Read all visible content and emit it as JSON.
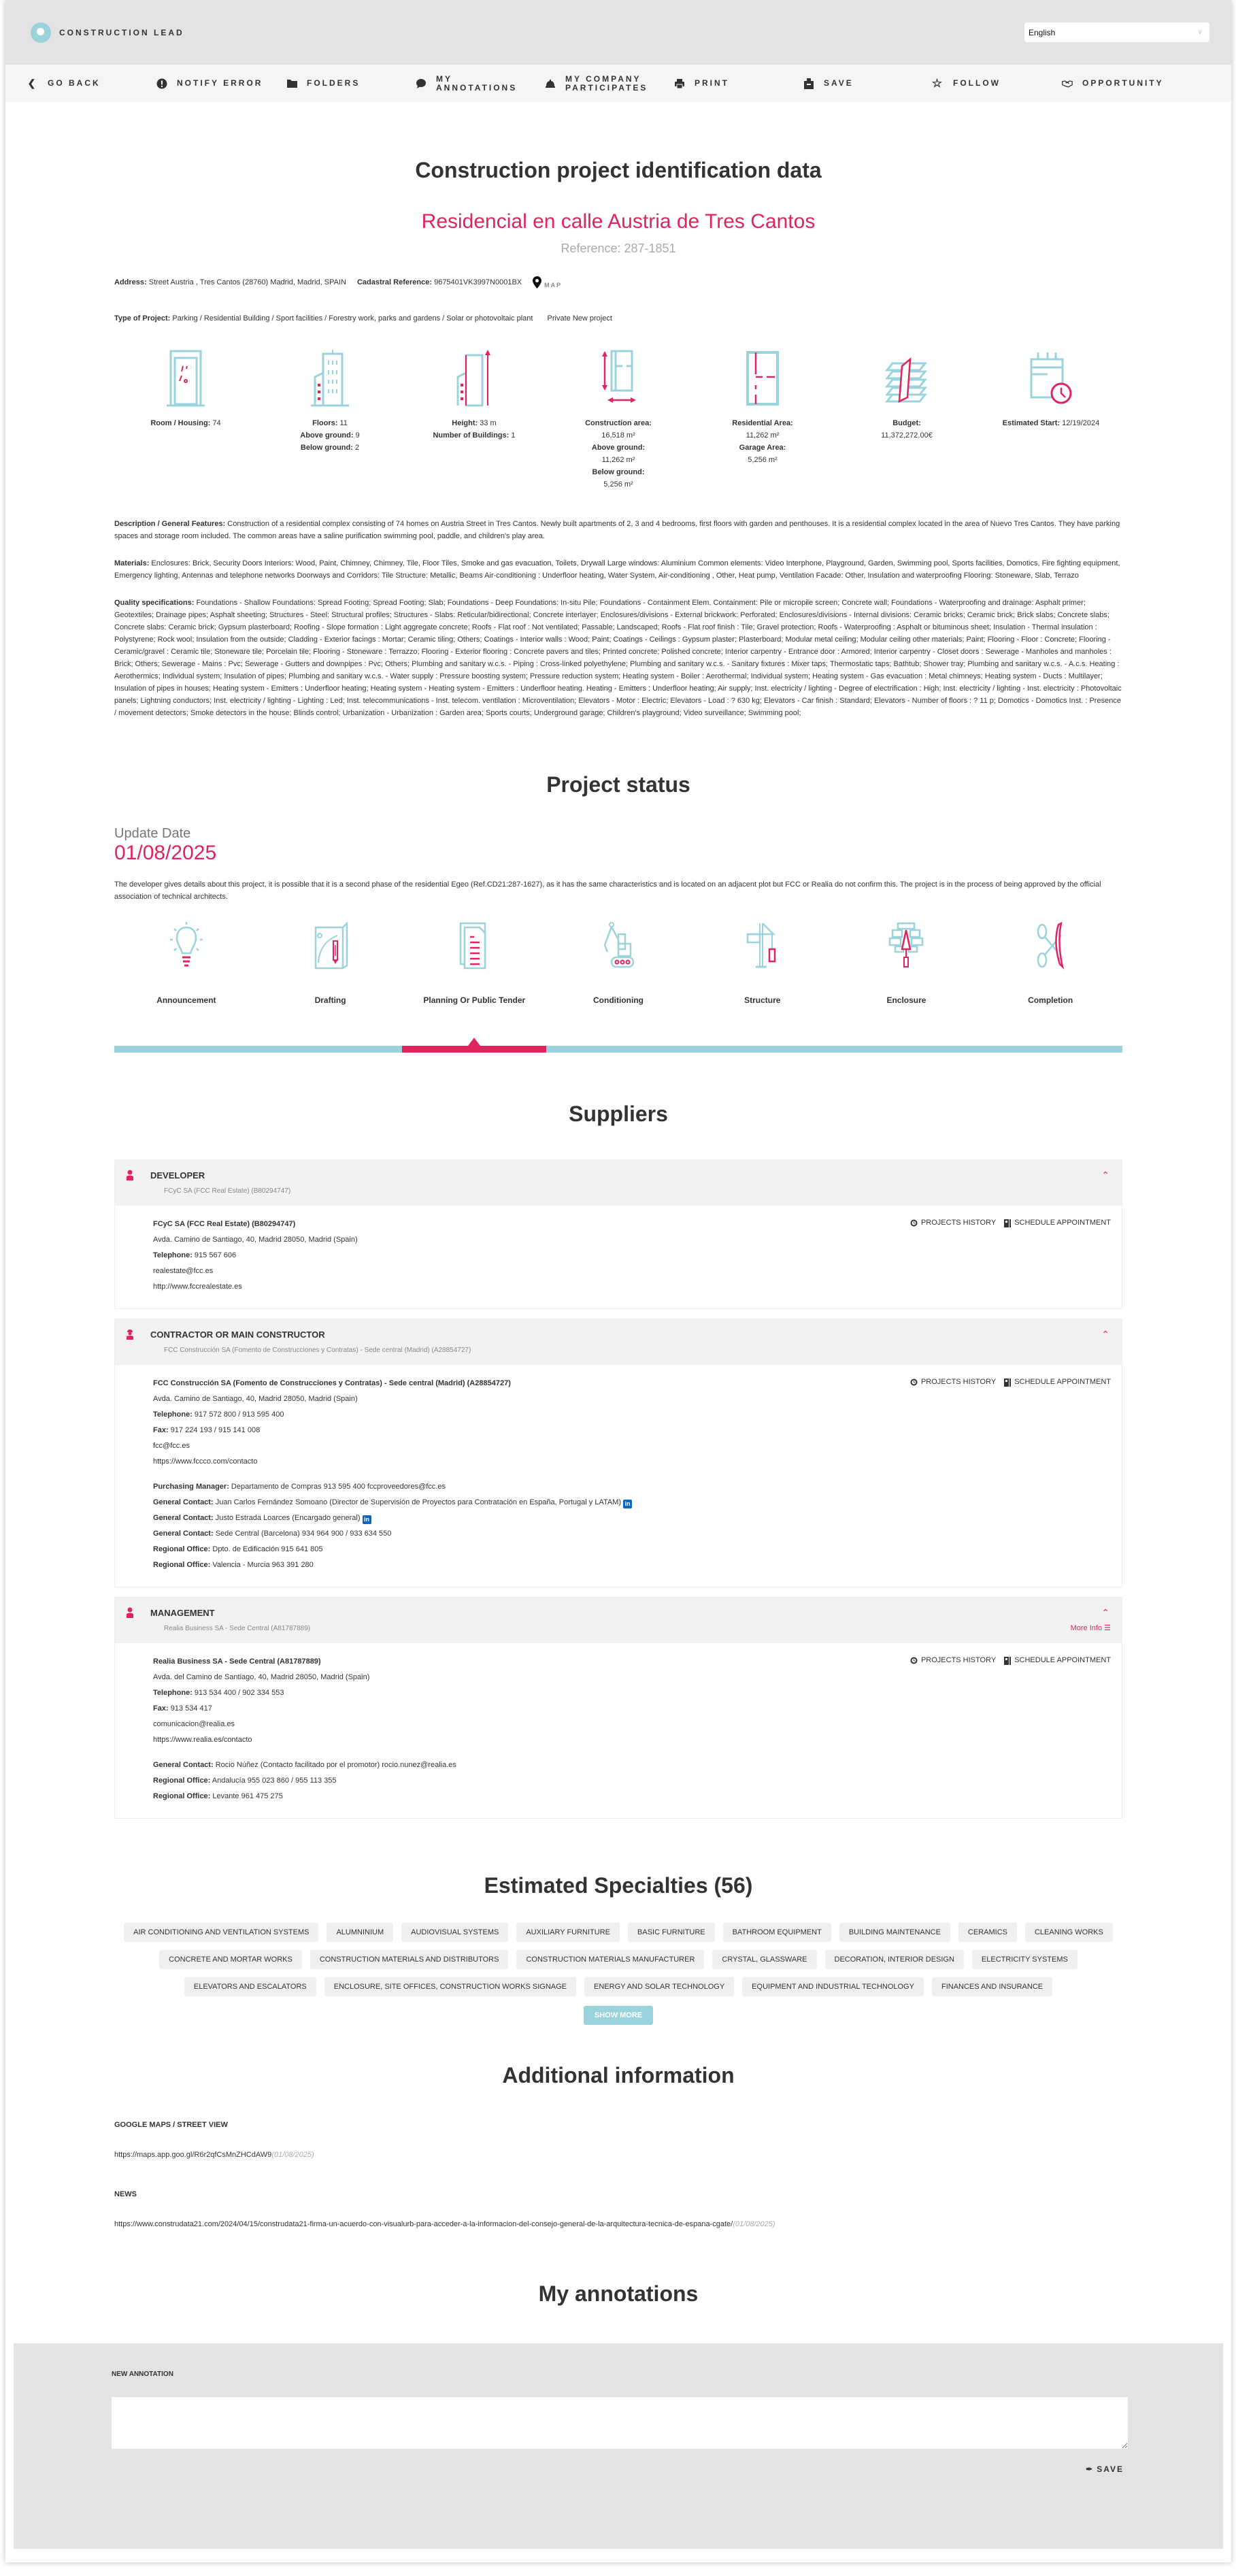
{
  "header": {
    "brand": "CONSTRUCTION LEAD",
    "language": "English"
  },
  "toolbar": {
    "items": [
      {
        "label": "GO BACK",
        "icon": "chevron-left-icon"
      },
      {
        "label": "NOTIFY ERROR",
        "icon": "exclamation-icon"
      },
      {
        "label": "FOLDERS",
        "icon": "folder-icon"
      },
      {
        "label": "MY ANNOTATIONS",
        "icon": "comment-icon"
      },
      {
        "label": "MY COMPANY PARTICIPATES",
        "icon": "hardhat-icon"
      },
      {
        "label": "PRINT",
        "icon": "print-icon"
      },
      {
        "label": "SAVE",
        "icon": "save-icon"
      },
      {
        "label": "FOLLOW",
        "icon": "star-icon"
      },
      {
        "label": "OPPORTUNITY",
        "icon": "handshake-icon"
      }
    ]
  },
  "identification": {
    "section_title": "Construction project identification data",
    "project_name": "Residencial en calle Austria de Tres Cantos",
    "reference": "Reference: 287-1851",
    "address_label": "Address:",
    "address": "Street Austria , Tres Cantos (28760) Madrid, Madrid, SPAIN",
    "cadastral_label": "Cadastral Reference:",
    "cadastral": "9675401VK3997N0001BX",
    "map_label": "MAP",
    "type_label": "Type of Project:",
    "type": "Parking / Residential Building / Sport facilities / Forestry work, parks and gardens / Solar or photovoltaic plant",
    "ownership": "Private New project"
  },
  "stats": [
    {
      "icon": "door-icon",
      "lines": [
        {
          "label": "Room / Housing:",
          "value": "74"
        }
      ]
    },
    {
      "icon": "building-floors-icon",
      "lines": [
        {
          "label": "Floors:",
          "value": "11"
        },
        {
          "label": "Above ground:",
          "value": "9"
        },
        {
          "label": "Below ground:",
          "value": "2"
        }
      ]
    },
    {
      "icon": "building-height-icon",
      "lines": [
        {
          "label": "Height:",
          "value": "33 m"
        },
        {
          "label": "Number of Buildings:",
          "value": "1"
        }
      ]
    },
    {
      "icon": "construction-area-icon",
      "lines": [
        {
          "label": "Construction area:",
          "value": ""
        },
        {
          "label": "",
          "value": "16,518 m²"
        },
        {
          "label": "Above ground:",
          "value": ""
        },
        {
          "label": "",
          "value": "11,262 m²"
        },
        {
          "label": "Below ground:",
          "value": ""
        },
        {
          "label": "",
          "value": "5,256 m²"
        }
      ]
    },
    {
      "icon": "floor-plan-icon",
      "lines": [
        {
          "label": "Residential Area:",
          "value": ""
        },
        {
          "label": "",
          "value": "11,262 m²"
        },
        {
          "label": "Garage Area:",
          "value": ""
        },
        {
          "label": "",
          "value": "5,256 m²"
        }
      ]
    },
    {
      "icon": "budget-icon",
      "lines": [
        {
          "label": "Budget:",
          "value": ""
        },
        {
          "label": "",
          "value": "11,372,272.00€"
        }
      ]
    },
    {
      "icon": "calendar-clock-icon",
      "lines": [
        {
          "label": "Estimated Start:",
          "value": "12/19/2024"
        }
      ]
    }
  ],
  "description": {
    "label": "Description / General Features:",
    "text": "Construction of a residential complex consisting of 74 homes on Austria Street in Tres Cantos. Newly built apartments of 2, 3 and 4 bedrooms, first floors with garden and penthouses. It is a residential complex located in the area of Nuevo Tres Cantos. They have parking spaces and storage room included. The common areas have a saline purification swimming pool, paddle, and children's play area."
  },
  "materials": {
    "label": "Materials:",
    "text": "Enclosures: Brick, Security Doors Interiors: Wood, Paint, Chimney, Chimney, Tile, Floor Tiles, Smoke and gas evacuation, Toilets, Drywall Large windows: Aluminium Common elements: Video Interphone, Playground, Garden, Swimming pool, Sports facilities, Domotics, Fire fighting equipment, Emergency lighting, Antennas and telephone networks Doorways and Corridors: Tile Structure: Metallic, Beams Air-conditioning : Underfloor heating, Water System, Air-conditioning , Other, Heat pump, Ventilation Facade: Other, Insulation and waterproofing Flooring: Stoneware, Slab, Terrazo"
  },
  "quality": {
    "label": "Quality specifications:",
    "text": "Foundations - Shallow Foundations: Spread Footing; Spread Footing; Slab; Foundations - Deep Foundations: In-situ Pile; Foundations - Containment Elem. Containment: Pile or micropile screen; Concrete wall; Foundations - Waterproofing and drainage: Asphalt primer; Geotextiles; Drainage pipes; Asphalt sheeting; Structures - Steel: Structural profiles; Structures - Slabs: Reticular/bidirectional; Concrete interlayer; Enclosures/divisions - External brickwork: Perforated; Enclosures/divisions - Internal divisions: Ceramic bricks; Ceramic brick; Brick slabs; Concrete slabs; Concrete slabs: Ceramic brick; Gypsum plasterboard; Roofing - Slope formation : Light aggregate concrete; Roofs - Flat roof : Not ventilated; Passable; Landscaped; Roofs - Flat roof finish : Tile; Gravel protection; Roofs - Waterproofing : Asphalt or bituminous sheet; Insulation - Thermal insulation : Polystyrene; Rock wool; Insulation from the outside; Cladding - Exterior facings : Mortar; Ceramic tiling; Others; Coatings - Interior walls : Wood; Paint; Coatings - Ceilings : Gypsum plaster; Plasterboard; Modular metal ceiling; Modular ceiling other materials; Paint; Flooring - Floor : Concrete; Flooring - Ceramic/gravel : Ceramic tile; Stoneware tile; Porcelain tile; Flooring - Stoneware : Terrazzo; Flooring - Exterior flooring : Concrete pavers and tiles; Printed concrete; Polished concrete; Interior carpentry - Entrance door : Armored; Interior carpentry - Closet doors : Sewerage - Manholes and manholes : Brick; Others; Sewerage - Mains : Pvc; Sewerage - Gutters and downpipes : Pvc; Others; Plumbing and sanitary w.c.s. - Piping : Cross-linked polyethylene; Plumbing and sanitary w.c.s. - Sanitary fixtures : Mixer taps; Thermostatic taps; Bathtub; Shower tray; Plumbing and sanitary w.c.s. - A.c.s. Heating : Aerothermics; Individual system; Insulation of pipes; Plumbing and sanitary w.c.s. - Water supply : Pressure boosting system; Pressure reduction system; Heating system - Boiler : Aerothermal; Individual system; Heating system - Gas evacuation : Metal chimneys; Heating system - Ducts : Multilayer; Insulation of pipes in houses; Heating system - Emitters : Underfloor heating; Heating system - Heating system - Emitters : Underfloor heating. Heating - Emitters : Underfloor heating; Air supply; Inst. electricity / lighting - Degree of electrification : High; Inst. electricity / lighting - Inst. electricity : Photovoltaic panels; Lightning conductors; Inst. electricity / lighting - Lighting : Led; Inst. telecommunications - Inst. telecom. ventilation : Microventilation; Elevators - Motor : Electric; Elevators - Load : ? 630 kg; Elevators - Car finish : Standard; Elevators - Number of floors : ? 11 p; Domotics - Domotics Inst. : Presence / movement detectors; Smoke detectors in the house; Blinds control; Urbanization - Urbanization : Garden area; Sports courts; Underground garage; Children's playground; Video surveillance; Swimming pool;"
  },
  "status": {
    "section_title": "Project status",
    "update_label": "Update Date",
    "update_date": "01/08/2025",
    "note": "The developer gives details about this project, it is possible that it is a second phase of the residential Egeo (Ref.CD21:287-1627), as it has the same characteristics and is located on an adjacent plot but FCC or Realia do not confirm this. The project is in the process of being approved by the official association of technical architects.",
    "phases": [
      {
        "label": "Announcement",
        "icon": "lightbulb-icon"
      },
      {
        "label": "Drafting",
        "icon": "blueprint-pencil-icon"
      },
      {
        "label": "Planning Or Public Tender",
        "icon": "document-list-icon"
      },
      {
        "label": "Conditioning",
        "icon": "excavator-icon"
      },
      {
        "label": "Structure",
        "icon": "crane-icon"
      },
      {
        "label": "Enclosure",
        "icon": "trowel-bricks-icon"
      },
      {
        "label": "Completion",
        "icon": "scissors-ribbon-icon"
      }
    ],
    "current_phase_index": 2,
    "total_phases": 7
  },
  "suppliers": {
    "section_title": "Suppliers",
    "projects_history_label": "PROJECTS HISTORY",
    "schedule_label": "SCHEDULE APPOINTMENT",
    "list": [
      {
        "role": "DEVELOPER",
        "summary": "FCyC SA (FCC Real Estate) (B80294747)",
        "name": "FCyC SA (FCC Real Estate) (B80294747)",
        "address": "Avda. Camino de Santiago, 40, Madrid 28050, Madrid (Spain)",
        "telephone_label": "Telephone:",
        "telephone": "915 567 606",
        "email": "realestate@fcc.es",
        "web": "http://www.fccrealestate.es",
        "contacts": []
      },
      {
        "role": "CONTRACTOR OR MAIN CONSTRUCTOR",
        "summary": "FCC Construcción SA (Fomento de Construcciones y Contratas) - Sede central (Madrid) (A28854727)",
        "name": "FCC Construcción SA (Fomento de Construcciones y Contratas) - Sede central (Madrid) (A28854727)",
        "address": "Avda. Camino de Santiago, 40, Madrid 28050, Madrid (Spain)",
        "telephone_label": "Telephone:",
        "telephone": "917 572 800 / 913 595 400",
        "fax_label": "Fax:",
        "fax": "917 224 193 / 915 141 008",
        "email": "fcc@fcc.es",
        "web": "https://www.fccco.com/contacto",
        "contacts": [
          {
            "label": "Purchasing Manager:",
            "value": "Departamento de Compras 913 595 400 fccproveedores@fcc.es",
            "linkedin": false
          },
          {
            "label": "General Contact:",
            "value": "Juan Carlos Fernández Somoano (Director de Supervisión de Proyectos para Contratación en España, Portugal y LATAM)",
            "linkedin": true
          },
          {
            "label": "General Contact:",
            "value": "Justo Estrada Loarces (Encargado general)",
            "linkedin": true
          },
          {
            "label": "General Contact:",
            "value": "Sede Central (Barcelona) 934 964 900 / 933 634 550",
            "linkedin": false
          },
          {
            "label": "Regional Office:",
            "value": "Dpto. de Edificación 915 641 805",
            "linkedin": false
          },
          {
            "label": "Regional Office:",
            "value": "Valencia - Murcia 963 391 280",
            "linkedin": false
          }
        ]
      },
      {
        "role": "MANAGEMENT",
        "summary": "Realia Business SA - Sede Central (A81787889)",
        "more_info": "More Info",
        "name": "Realia Business SA - Sede Central (A81787889)",
        "address": "Avda. del Camino de Santiago, 40, Madrid 28050, Madrid (Spain)",
        "telephone_label": "Telephone:",
        "telephone": "913 534 400 / 902 334 553",
        "fax_label": "Fax:",
        "fax": "913 534 417",
        "email": "comunicacion@realia.es",
        "web": "https://www.realia.es/contacto",
        "contacts": [
          {
            "label": "General Contact:",
            "value": "Rocio Núñez (Contacto facilitado por el promotor) rocio.nunez@realia.es",
            "linkedin": false
          },
          {
            "label": "Regional Office:",
            "value": "Andalucía 955 023 860 / 955 113 355",
            "linkedin": false
          },
          {
            "label": "Regional Office:",
            "value": "Levante 961 475 275",
            "linkedin": false
          }
        ]
      }
    ]
  },
  "specialties": {
    "section_title": "Estimated Specialties (56)",
    "rows": [
      [
        "AIR CONDITIONING AND VENTILATION SYSTEMS",
        "ALUMNINIUM",
        "AUDIOVISUAL SYSTEMS",
        "AUXILIARY FURNITURE",
        "BASIC FURNITURE",
        "BATHROOM EQUIPMENT",
        "BUILDING MAINTENANCE",
        "CERAMICS",
        "CLEANING WORKS"
      ],
      [
        "CONCRETE AND MORTAR WORKS",
        "CONSTRUCTION MATERIALS AND DISTRIBUTORS",
        "CONSTRUCTION MATERIALS MANUFACTURER",
        "CRYSTAL, GLASSWARE",
        "DECORATION, INTERIOR DESIGN",
        "ELECTRICITY SYSTEMS"
      ],
      [
        "ELEVATORS AND ESCALATORS",
        "ENCLOSURE, SITE OFFICES, CONSTRUCTION WORKS SIGNAGE",
        "ENERGY AND SOLAR TECHNOLOGY",
        "EQUIPMENT AND INDUSTRIAL TECHNOLOGY",
        "FINANCES AND INSURANCE"
      ]
    ],
    "show_more": "SHOW MORE"
  },
  "additional": {
    "section_title": "Additional information",
    "groups": [
      {
        "label": "GOOGLE MAPS / STREET VIEW",
        "link": "https://maps.app.goo.gl/R6r2qfCsMnZHCdAW9",
        "date": "(01/08/2025)"
      },
      {
        "label": "NEWS",
        "link": "https://www.construdata21.com/2024/04/15/construdata21-firma-un-acuerdo-con-visualurb-para-acceder-a-la-informacion-del-consejo-general-de-la-arquitectura-tecnica-de-espana-cgate/",
        "date": "(01/08/2025)"
      }
    ]
  },
  "annotations": {
    "section_title": "My annotations",
    "new_label": "NEW ANNOTATION",
    "textarea_value": "",
    "save_label": "SAVE"
  },
  "colors": {
    "accent_pink": "#e0245e",
    "accent_teal": "#9ad3dc",
    "header_bg": "#e3e3e3",
    "toolbar_bg": "#f5f5f5"
  }
}
